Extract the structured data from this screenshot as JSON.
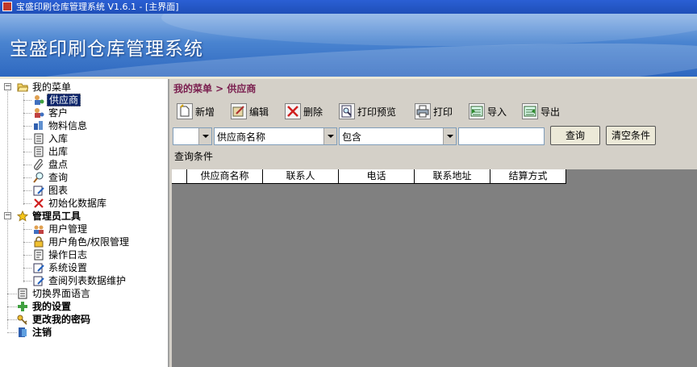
{
  "window": {
    "title": "宝盛印刷仓库管理系统 V1.6.1 - [主界面]"
  },
  "banner": {
    "title": "宝盛印刷仓库管理系统"
  },
  "tree": {
    "root": "我的菜单",
    "menu_items": [
      "供应商",
      "客户",
      "物料信息",
      "入库",
      "出库",
      "盘点",
      "查询",
      "图表",
      "初始化数据库"
    ],
    "admin_group": "管理员工具",
    "admin_items": [
      "用户管理",
      "用户角色/权限管理",
      "操作日志",
      "系统设置",
      "查阅列表数据维护"
    ],
    "language": "切换界面语言",
    "settings": "我的设置",
    "password": "更改我的密码",
    "logout": "注销"
  },
  "breadcrumb": "我的菜单 > 供应商",
  "toolbar": {
    "add": "新增",
    "edit": "编辑",
    "delete": "删除",
    "print_preview": "打印预览",
    "print": "打印",
    "import": "导入",
    "export": "导出"
  },
  "filter": {
    "logic_value": "",
    "field_value": "供应商名称",
    "operator_value": "包含",
    "keyword_value": "",
    "query_button": "查询",
    "clear_button": "清空条件"
  },
  "query_conditions_label": "查询条件",
  "table": {
    "columns": [
      "供应商名称",
      "联系人",
      "电话",
      "联系地址",
      "结算方式"
    ]
  },
  "colors": {
    "selection": "#0a246a",
    "breadcrumb": "#7a1f4f",
    "grid_bg": "#808080"
  }
}
